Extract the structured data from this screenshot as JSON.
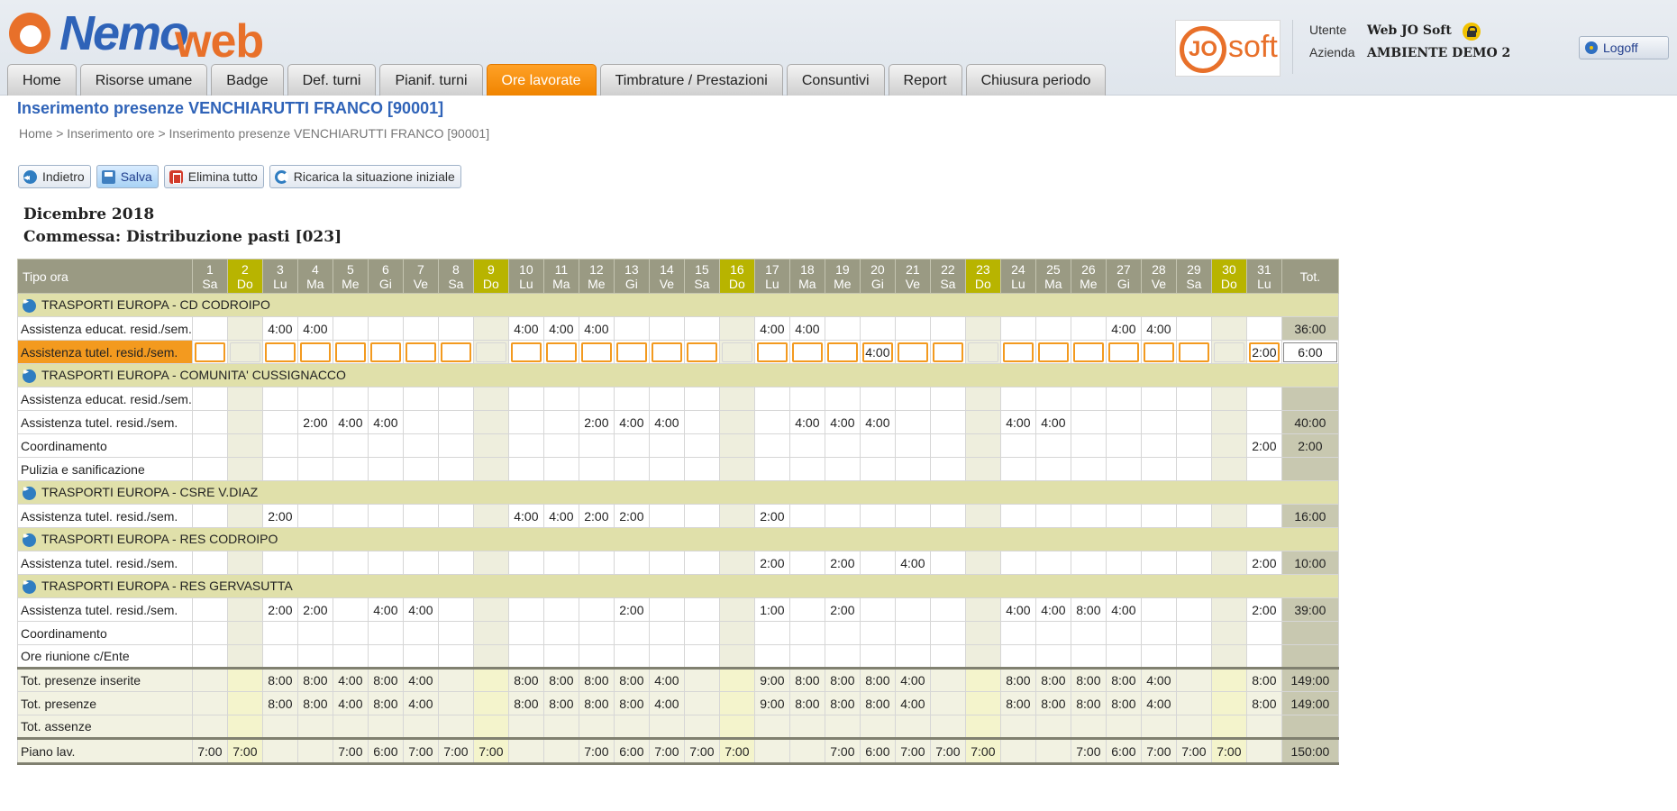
{
  "logo": {
    "part1": "Nemo",
    "part2": "web"
  },
  "josoft_logo": {
    "jo": "JO",
    "soft": "soft"
  },
  "user": {
    "utente_label": "Utente",
    "utente_value": "Web JO Soft",
    "azienda_label": "Azienda",
    "azienda_value": "AMBIENTE DEMO 2"
  },
  "logoff_label": "Logoff",
  "tabs": [
    "Home",
    "Risorse umane",
    "Badge",
    "Def. turni",
    "Pianif. turni",
    "Ore lavorate",
    "Timbrature / Prestazioni",
    "Consuntivi",
    "Report",
    "Chiusura periodo"
  ],
  "active_tab": "Ore lavorate",
  "page_title": "Inserimento presenze VENCHIARUTTI FRANCO [90001]",
  "breadcrumb": "Home > Inserimento ore > Inserimento presenze VENCHIARUTTI FRANCO [90001]",
  "toolbar": {
    "back": "Indietro",
    "save": "Salva",
    "delete_all": "Elimina tutto",
    "reload": "Ricarica la situazione iniziale"
  },
  "month": "Dicembre 2018",
  "commessa": "Commessa: Distribuzione pasti [023]",
  "grid": {
    "type_header": "Tipo ora",
    "total_header": "Tot.",
    "days": [
      {
        "n": "1",
        "d": "Sa"
      },
      {
        "n": "2",
        "d": "Do"
      },
      {
        "n": "3",
        "d": "Lu"
      },
      {
        "n": "4",
        "d": "Ma"
      },
      {
        "n": "5",
        "d": "Me"
      },
      {
        "n": "6",
        "d": "Gi"
      },
      {
        "n": "7",
        "d": "Ve"
      },
      {
        "n": "8",
        "d": "Sa"
      },
      {
        "n": "9",
        "d": "Do"
      },
      {
        "n": "10",
        "d": "Lu"
      },
      {
        "n": "11",
        "d": "Ma"
      },
      {
        "n": "12",
        "d": "Me"
      },
      {
        "n": "13",
        "d": "Gi"
      },
      {
        "n": "14",
        "d": "Ve"
      },
      {
        "n": "15",
        "d": "Sa"
      },
      {
        "n": "16",
        "d": "Do"
      },
      {
        "n": "17",
        "d": "Lu"
      },
      {
        "n": "18",
        "d": "Ma"
      },
      {
        "n": "19",
        "d": "Me"
      },
      {
        "n": "20",
        "d": "Gi"
      },
      {
        "n": "21",
        "d": "Ve"
      },
      {
        "n": "22",
        "d": "Sa"
      },
      {
        "n": "23",
        "d": "Do"
      },
      {
        "n": "24",
        "d": "Lu"
      },
      {
        "n": "25",
        "d": "Ma"
      },
      {
        "n": "26",
        "d": "Me"
      },
      {
        "n": "27",
        "d": "Gi"
      },
      {
        "n": "28",
        "d": "Ve"
      },
      {
        "n": "29",
        "d": "Sa"
      },
      {
        "n": "30",
        "d": "Do"
      },
      {
        "n": "31",
        "d": "Lu"
      }
    ],
    "sundays": [
      2,
      9,
      16,
      23,
      30
    ],
    "groups": [
      {
        "title": "TRASPORTI EUROPA - CD CODROIPO",
        "rows": [
          {
            "label": "Assistenza educat. resid./sem.",
            "cells": {
              "3": "4:00",
              "4": "4:00",
              "10": "4:00",
              "11": "4:00",
              "12": "4:00",
              "17": "4:00",
              "18": "4:00",
              "27": "4:00",
              "28": "4:00"
            },
            "total": "36:00"
          },
          {
            "label": "Assistenza tutel. resid./sem.",
            "editing": true,
            "cells": {
              "20": "4:00",
              "31": "2:00"
            },
            "total": "6:00"
          }
        ]
      },
      {
        "title": "TRASPORTI EUROPA - COMUNITA' CUSSIGNACCO",
        "rows": [
          {
            "label": "Assistenza educat. resid./sem.",
            "cells": {},
            "total": ""
          },
          {
            "label": "Assistenza tutel. resid./sem.",
            "cells": {
              "4": "2:00",
              "5": "4:00",
              "6": "4:00",
              "12": "2:00",
              "13": "4:00",
              "14": "4:00",
              "18": "4:00",
              "19": "4:00",
              "20": "4:00",
              "24": "4:00",
              "25": "4:00"
            },
            "total": "40:00"
          },
          {
            "label": "Coordinamento",
            "cells": {
              "31": "2:00"
            },
            "total": "2:00"
          },
          {
            "label": "Pulizia e sanificazione",
            "cells": {},
            "total": ""
          }
        ]
      },
      {
        "title": "TRASPORTI EUROPA - CSRE V.DIAZ",
        "rows": [
          {
            "label": "Assistenza tutel. resid./sem.",
            "cells": {
              "3": "2:00",
              "10": "4:00",
              "11": "4:00",
              "12": "2:00",
              "13": "2:00",
              "17": "2:00"
            },
            "total": "16:00"
          }
        ]
      },
      {
        "title": "TRASPORTI EUROPA - RES CODROIPO",
        "rows": [
          {
            "label": "Assistenza tutel. resid./sem.",
            "cells": {
              "17": "2:00",
              "19": "2:00",
              "21": "4:00",
              "31": "2:00"
            },
            "total": "10:00"
          }
        ]
      },
      {
        "title": "TRASPORTI EUROPA - RES GERVASUTTA",
        "rows": [
          {
            "label": "Assistenza tutel. resid./sem.",
            "cells": {
              "3": "2:00",
              "4": "2:00",
              "6": "4:00",
              "7": "4:00",
              "13": "2:00",
              "17": "1:00",
              "19": "2:00",
              "24": "4:00",
              "25": "4:00",
              "26": "8:00",
              "27": "4:00",
              "31": "2:00"
            },
            "total": "39:00"
          },
          {
            "label": "Coordinamento",
            "cells": {},
            "total": ""
          },
          {
            "label": "Ore riunione c/Ente",
            "cells": {},
            "total": ""
          }
        ]
      }
    ],
    "summary": [
      {
        "label": "Tot. presenze inserite",
        "cells": {
          "3": "8:00",
          "4": "8:00",
          "5": "4:00",
          "6": "8:00",
          "7": "4:00",
          "10": "8:00",
          "11": "8:00",
          "12": "8:00",
          "13": "8:00",
          "14": "4:00",
          "17": "9:00",
          "18": "8:00",
          "19": "8:00",
          "20": "8:00",
          "21": "4:00",
          "24": "8:00",
          "25": "8:00",
          "26": "8:00",
          "27": "8:00",
          "28": "4:00",
          "31": "8:00"
        },
        "total": "149:00"
      },
      {
        "label": "Tot. presenze",
        "cells": {
          "3": "8:00",
          "4": "8:00",
          "5": "4:00",
          "6": "8:00",
          "7": "4:00",
          "10": "8:00",
          "11": "8:00",
          "12": "8:00",
          "13": "8:00",
          "14": "4:00",
          "17": "9:00",
          "18": "8:00",
          "19": "8:00",
          "20": "8:00",
          "21": "4:00",
          "24": "8:00",
          "25": "8:00",
          "26": "8:00",
          "27": "8:00",
          "28": "4:00",
          "31": "8:00"
        },
        "total": "149:00"
      },
      {
        "label": "Tot. assenze",
        "cells": {},
        "total": ""
      }
    ],
    "plan": {
      "label": "Piano lav.",
      "cells": {
        "1": "7:00",
        "2": "7:00",
        "5": "7:00",
        "6": "6:00",
        "7": "7:00",
        "8": "7:00",
        "9": "7:00",
        "12": "7:00",
        "13": "6:00",
        "14": "7:00",
        "15": "7:00",
        "16": "7:00",
        "19": "7:00",
        "20": "6:00",
        "21": "7:00",
        "22": "7:00",
        "23": "7:00",
        "26": "7:00",
        "27": "6:00",
        "28": "7:00",
        "29": "7:00",
        "30": "7:00"
      },
      "total": "150:00"
    }
  }
}
